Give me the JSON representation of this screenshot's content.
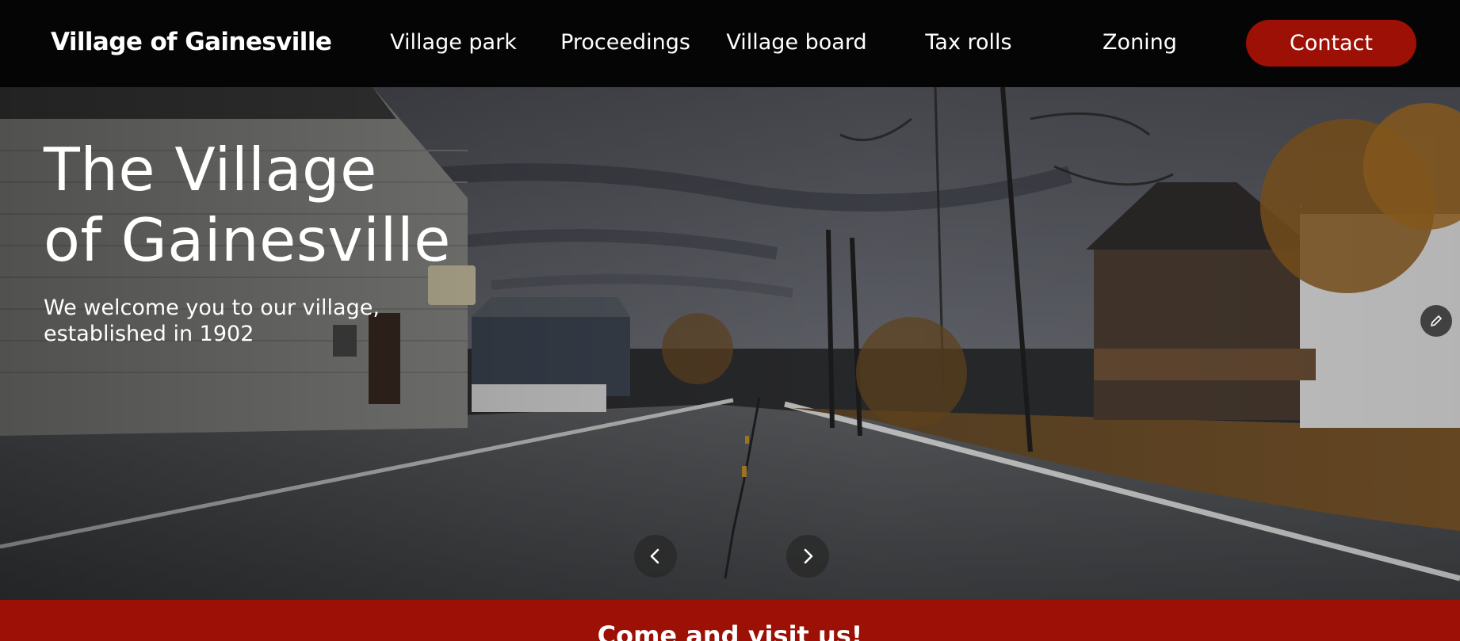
{
  "header": {
    "brand": "Village of Gainesville",
    "nav": [
      {
        "label": "Village park"
      },
      {
        "label": "Proceedings"
      },
      {
        "label": "Village board"
      },
      {
        "label": "Tax rolls"
      },
      {
        "label": "Zoning"
      }
    ],
    "contact_label": "Contact",
    "accent_color": "#9c1006"
  },
  "hero": {
    "title_line1": "The Village",
    "title_line2": "of Gainesville",
    "subtitle_line1": "We welcome you to our village,",
    "subtitle_line2": "established in 1902",
    "prev_icon": "chevron-left-icon",
    "next_icon": "chevron-right-icon",
    "edit_icon": "pencil-icon"
  },
  "visit": {
    "title": "Come and visit us!"
  }
}
